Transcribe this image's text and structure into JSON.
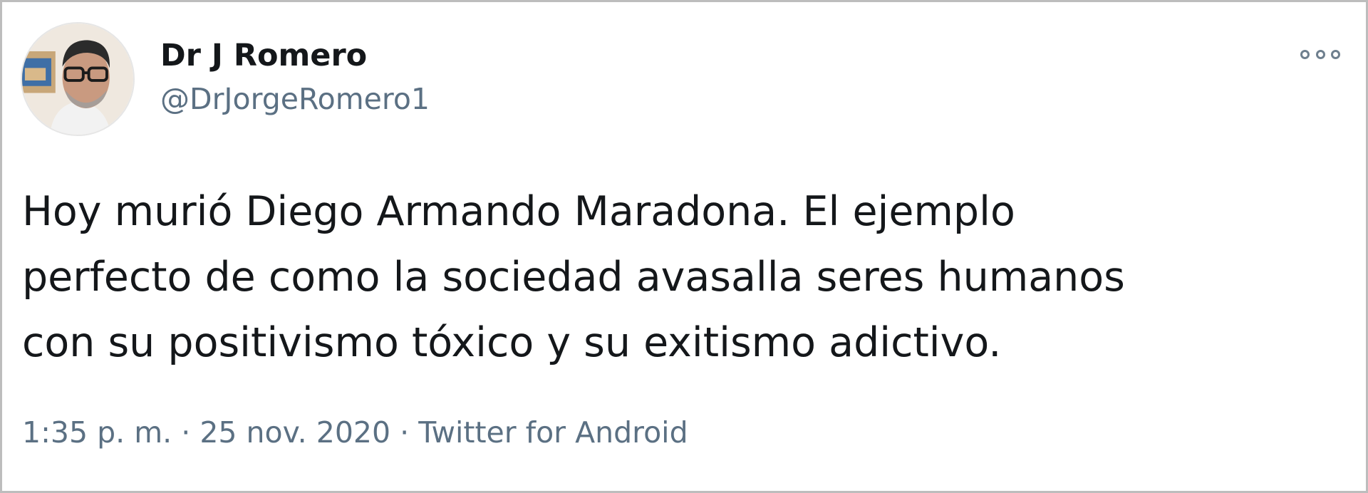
{
  "author": {
    "display_name": "Dr J Romero",
    "handle": "@DrJorgeRomero1"
  },
  "tweet": {
    "text_lines": [
      "Hoy murió Diego Armando Maradona. El ejemplo",
      "perfecto de como la sociedad avasalla seres humanos",
      "con su positivismo tóxico y su exitismo adictivo."
    ]
  },
  "meta": {
    "time": "1:35 p. m.",
    "separator": "·",
    "date": "25 nov. 2020",
    "source": "Twitter for Android"
  },
  "icons": {
    "more": "more-options-icon"
  },
  "colors": {
    "text_primary": "#14171a",
    "text_secondary": "#5b7083",
    "border": "#bdbdbd"
  }
}
